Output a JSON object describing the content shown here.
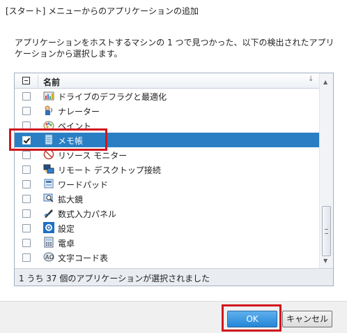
{
  "dialog": {
    "title": "[スタート] メニューからのアプリケーションの追加",
    "description": "アプリケーションをホストするマシンの 1 つで見つかった、以下の検出されたアプリケーションから選択します。"
  },
  "grid": {
    "column_name": "名前",
    "rows": [
      {
        "label": "ドライブのデフラグと最適化",
        "checked": false,
        "icon": "defrag-icon"
      },
      {
        "label": "ナレーター",
        "checked": false,
        "icon": "narrator-icon"
      },
      {
        "label": "ペイント",
        "checked": false,
        "icon": "paint-icon"
      },
      {
        "label": "メモ帳",
        "checked": true,
        "icon": "notepad-icon",
        "selected": true
      },
      {
        "label": "リソース モニター",
        "checked": false,
        "icon": "resource-monitor-icon"
      },
      {
        "label": "リモート デスクトップ接続",
        "checked": false,
        "icon": "remote-desktop-icon"
      },
      {
        "label": "ワードパッド",
        "checked": false,
        "icon": "wordpad-icon"
      },
      {
        "label": "拡大鏡",
        "checked": false,
        "icon": "magnifier-icon"
      },
      {
        "label": "数式入力パネル",
        "checked": false,
        "icon": "math-input-icon"
      },
      {
        "label": "設定",
        "checked": false,
        "icon": "settings-icon"
      },
      {
        "label": "電卓",
        "checked": false,
        "icon": "calculator-icon"
      },
      {
        "label": "文字コード表",
        "checked": false,
        "icon": "character-map-icon"
      }
    ],
    "status": "1 うち 37 個のアプリケーションが選択されました"
  },
  "buttons": {
    "ok": "OK",
    "cancel": "キャンセル"
  },
  "colors": {
    "selection": "#2a7fc4",
    "highlight_box": "#d0161c"
  }
}
